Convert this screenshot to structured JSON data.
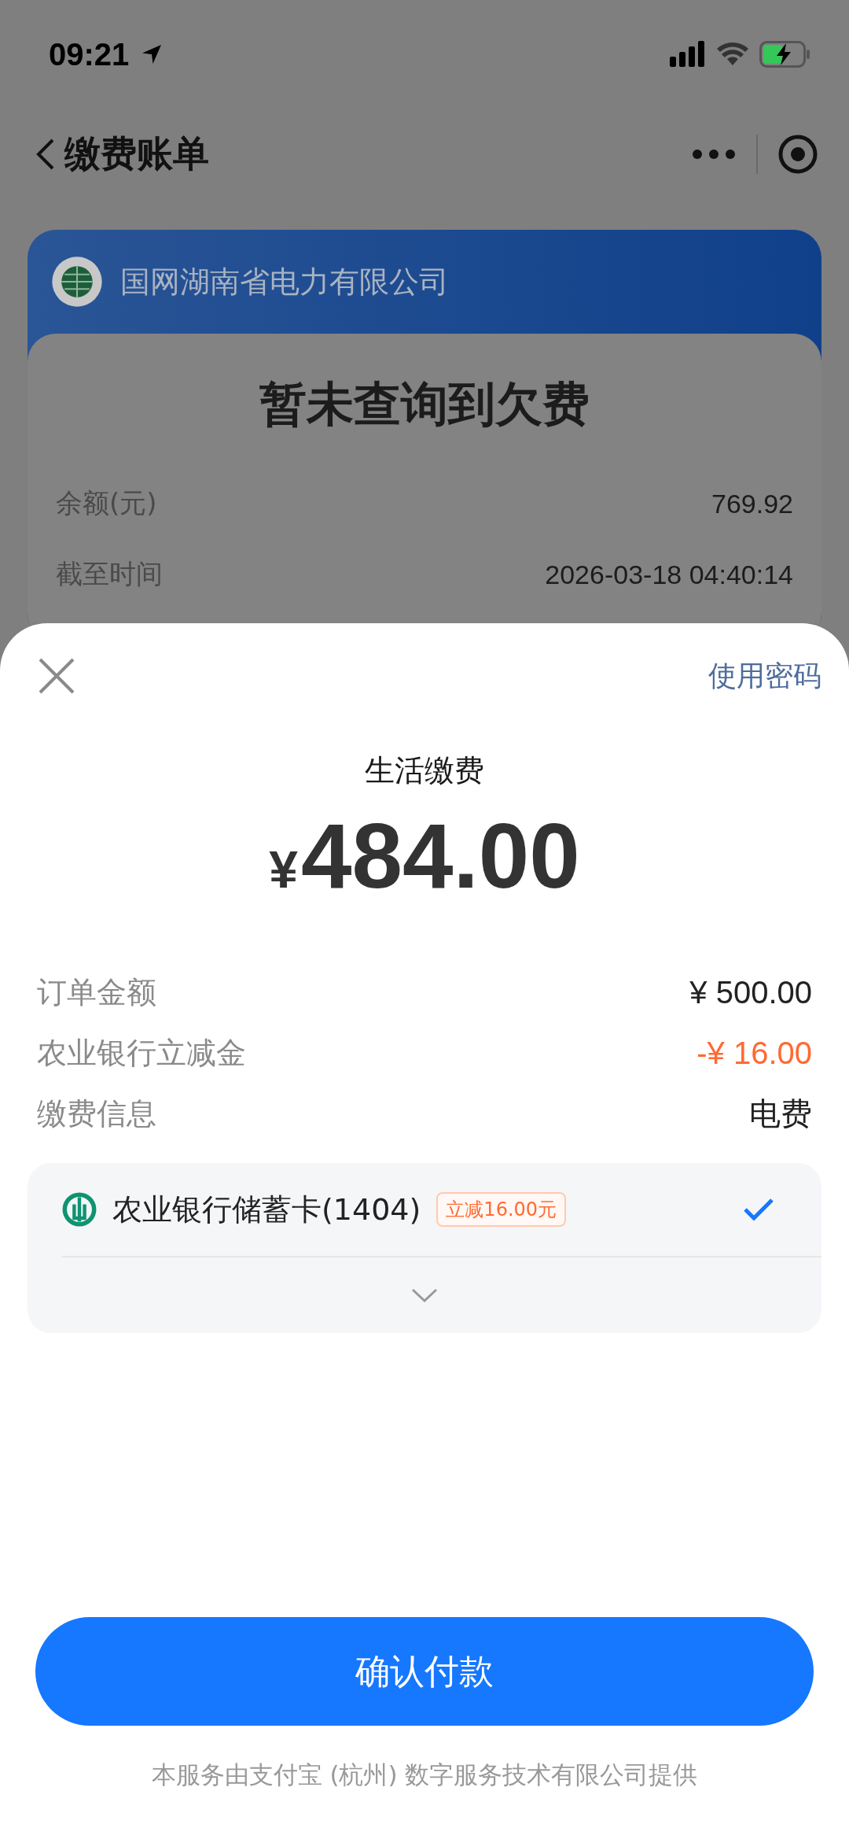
{
  "status_bar": {
    "time": "09:21"
  },
  "nav": {
    "title": "缴费账单"
  },
  "bill_card": {
    "company": "国网湖南省电力有限公司",
    "headline": "暂未查询到欠费",
    "rows": [
      {
        "label": "余额(元)",
        "value": "769.92"
      },
      {
        "label": "截至时间",
        "value": "2026-03-18 04:40:14"
      }
    ]
  },
  "pay_sheet": {
    "password_link": "使用密码",
    "title": "生活缴费",
    "currency": "¥",
    "amount": "484.00",
    "details": [
      {
        "label": "订单金额",
        "value": "¥ 500.00",
        "kind": "normal"
      },
      {
        "label": "农业银行立减金",
        "value": "-¥ 16.00",
        "kind": "discount"
      },
      {
        "label": "缴费信息",
        "value": "电费",
        "kind": "normal"
      }
    ],
    "methods": [
      {
        "name": "农业银行储蓄卡(1404)",
        "badge": "立减16.00元",
        "selected": true
      }
    ],
    "confirm_button": "确认付款",
    "footer": "本服务由支付宝 (杭州) 数字服务技术有限公司提供"
  }
}
